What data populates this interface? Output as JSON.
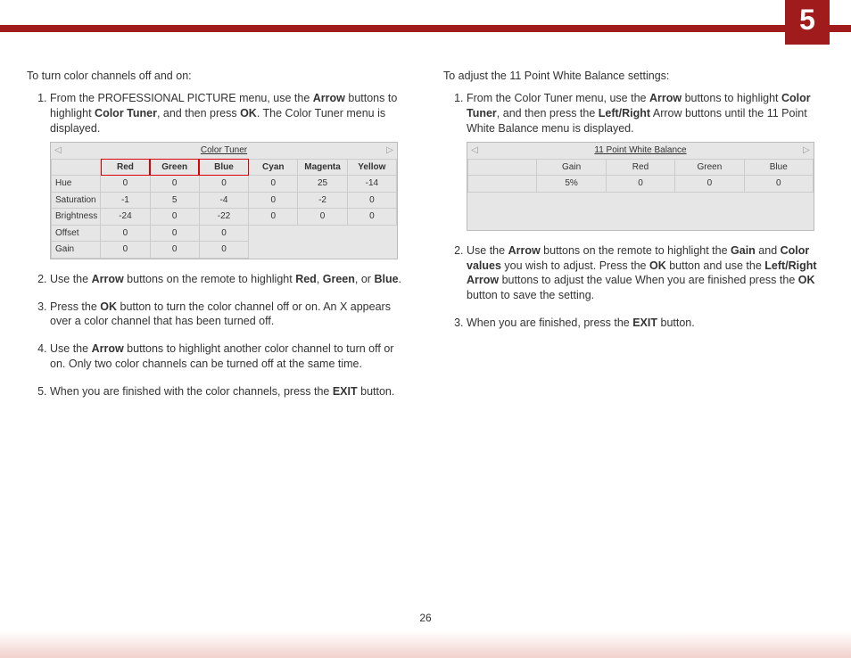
{
  "chapter": "5",
  "page_number": "26",
  "left": {
    "intro": "To turn color channels off and on:",
    "step1_a": "From the PROFESSIONAL PICTURE menu, use the ",
    "step1_b": "Arrow",
    "step1_c": " buttons to highlight ",
    "step1_d": "Color Tuner",
    "step1_e": ", and then press ",
    "step1_f": "OK",
    "step1_g": ". The Color Tuner menu is displayed.",
    "step2_a": "Use the ",
    "step2_b": "Arrow",
    "step2_c": " buttons on the remote to highlight ",
    "step2_d": "Red",
    "step2_e": ", ",
    "step2_f": "Green",
    "step2_g": ", or ",
    "step2_h": "Blue",
    "step2_i": ".",
    "step3_a": "Press the ",
    "step3_b": "OK",
    "step3_c": "  button to turn the color channel off or on. An X appears over a color channel that has been turned off.",
    "step4_a": "Use the ",
    "step4_b": "Arrow",
    "step4_c": " buttons to highlight another color channel to turn off or on. Only two color channels can be turned off at the same time.",
    "step5_a": "When you are finished with the color channels, press the ",
    "step5_b": "EXIT",
    "step5_c": " button."
  },
  "right": {
    "intro": "To adjust the 11 Point White Balance settings:",
    "step1_a": "From the Color Tuner menu, use the ",
    "step1_b": "Arrow",
    "step1_c": " buttons to highlight ",
    "step1_d": "Color Tuner",
    "step1_e": ", and then press the ",
    "step1_f": "Left/Right",
    "step1_g": " Arrow buttons until the 11 Point White Balance menu is displayed.",
    "step2_a": "Use the ",
    "step2_b": "Arrow",
    "step2_c": " buttons on the remote to highlight the ",
    "step2_d": "Gain",
    "step2_e": " and ",
    "step2_f": "Color values",
    "step2_g": " you wish to adjust. Press the ",
    "step2_h": "OK",
    "step2_i": "  button and use the ",
    "step2_j": "Left/Right Arrow",
    "step2_k": " buttons to adjust the value When you are finished press the ",
    "step2_l": "OK",
    "step2_m": " button to save the setting.",
    "step3_a": "When you are finished, press the ",
    "step3_b": "EXIT",
    "step3_c": " button."
  },
  "tuner": {
    "title": "Color Tuner",
    "arrow_left": "◁",
    "arrow_right": "▷",
    "cols": {
      "red": "Red",
      "green": "Green",
      "blue": "Blue",
      "cyan": "Cyan",
      "magenta": "Magenta",
      "yellow": "Yellow"
    },
    "rows": {
      "hue": {
        "label": "Hue",
        "red": "0",
        "green": "0",
        "blue": "0",
        "cyan": "0",
        "magenta": "25",
        "yellow": "-14"
      },
      "saturation": {
        "label": "Saturation",
        "red": "-1",
        "green": "5",
        "blue": "-4",
        "cyan": "0",
        "magenta": "-2",
        "yellow": "0"
      },
      "brightness": {
        "label": "Brightness",
        "red": "-24",
        "green": "0",
        "blue": "-22",
        "cyan": "0",
        "magenta": "0",
        "yellow": "0"
      },
      "offset": {
        "label": "Offset",
        "red": "0",
        "green": "0",
        "blue": "0"
      },
      "gain": {
        "label": "Gain",
        "red": "0",
        "green": "0",
        "blue": "0"
      }
    }
  },
  "wb": {
    "title": "11 Point White Balance",
    "arrow_left": "◁",
    "arrow_right": "▷",
    "cols": {
      "gain": "Gain",
      "red": "Red",
      "green": "Green",
      "blue": "Blue"
    },
    "row": {
      "gain": "5%",
      "red": "0",
      "green": "0",
      "blue": "0"
    }
  }
}
